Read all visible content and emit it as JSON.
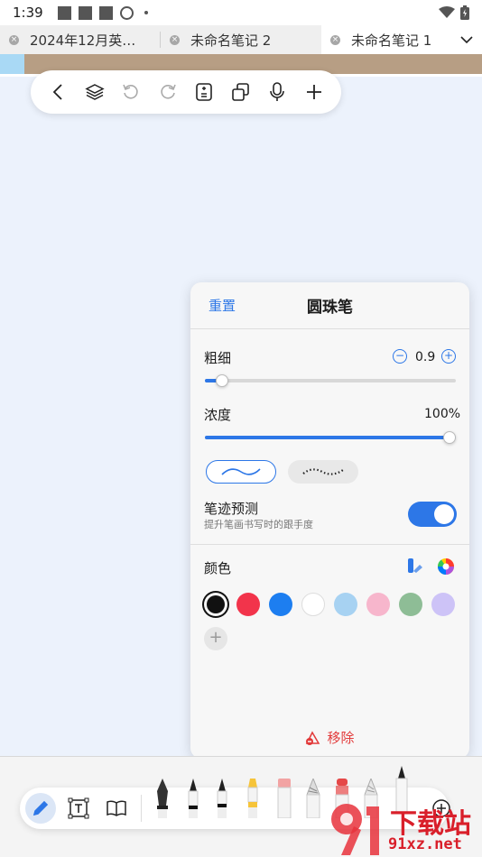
{
  "status_bar": {
    "time": "1:39"
  },
  "tabs": [
    {
      "label": "2024年12月英…",
      "active": false
    },
    {
      "label": "未命名笔记 2",
      "active": false
    },
    {
      "label": "未命名笔记 1",
      "active": true
    }
  ],
  "pen_panel": {
    "reset_label": "重置",
    "title": "圆珠笔",
    "thickness": {
      "label": "粗细",
      "value": "0.9",
      "fraction": 0.07
    },
    "opacity": {
      "label": "浓度",
      "value": "100%",
      "fraction": 1.0
    },
    "stroke_prediction": {
      "label": "笔迹预测",
      "description": "提升笔画书写时的跟手度",
      "enabled": true
    },
    "color": {
      "label": "颜色",
      "swatches": [
        "#111111",
        "#f2344b",
        "#1d7ef0",
        "#ffffff",
        "#a7d2f2",
        "#f7b6cc",
        "#8ebd96",
        "#cdc3f7"
      ],
      "selected_index": 0
    },
    "remove_label": "移除"
  },
  "watermark": {
    "brand": "下载站",
    "site": "91xz.net"
  }
}
